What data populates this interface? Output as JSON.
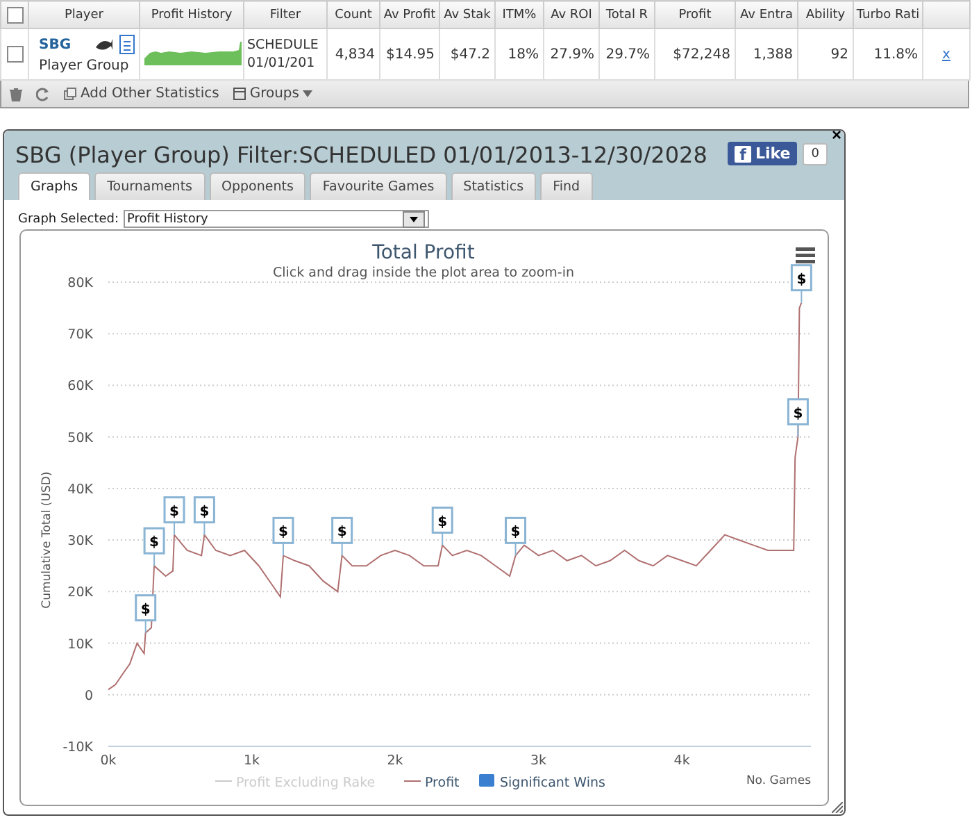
{
  "grid": {
    "columns": [
      "Player",
      "Profit History",
      "Filter",
      "Count",
      "Av Profit",
      "Av Stak",
      "ITM%",
      "Av ROI",
      "Total R",
      "Profit",
      "Av Entra",
      "Ability",
      "Turbo Rati"
    ],
    "header_checked": false,
    "rows": [
      {
        "checked": false,
        "cells": [
          {
            "name": "SBG",
            "group": "Player Group"
          },
          "",
          "SCHEDULE 01/01/201",
          "4,834",
          "$14.95",
          "$47.2",
          "18%",
          "27.9%",
          "29.7%",
          "$72,248",
          "1,388",
          "92",
          "11.8%"
        ],
        "remove": "x"
      }
    ],
    "toolbar": {
      "add_stats": "Add Other Statistics",
      "groups": "Groups"
    }
  },
  "dialog": {
    "title": "SBG (Player Group) Filter:SCHEDULED 01/01/2013-12/30/2028",
    "close": "×",
    "like": {
      "icon": "f",
      "label": "Like",
      "count": "0"
    },
    "tabs": [
      {
        "label": "Graphs",
        "selected": true
      },
      {
        "label": "Tournaments",
        "selected": false
      },
      {
        "label": "Opponents",
        "selected": false
      },
      {
        "label": "Favourite Games",
        "selected": false
      },
      {
        "label": "Statistics",
        "selected": false
      },
      {
        "label": "Find",
        "selected": false
      }
    ],
    "graph_select": {
      "label": "Graph Selected:",
      "value": "Profit History"
    },
    "chart": {
      "subtitle": "Click and drag inside the plot area to zoom-in",
      "legend": [
        {
          "label": "Profit Excluding Rake",
          "kind": "line",
          "enabled": false
        },
        {
          "kind": "series",
          "enabled": true
        },
        {
          "label": "Significant Wins",
          "kind": "square",
          "enabled": true
        }
      ],
      "chart_data": {
        "type": "line",
        "title": "Total Profit",
        "xlabel": "No. Games",
        "ylabel": "Cumulative Total (USD)",
        "x": [
          0,
          50,
          100,
          150,
          200,
          250,
          260,
          300,
          320,
          400,
          450,
          460,
          550,
          650,
          670,
          750,
          850,
          950,
          1050,
          1150,
          1200,
          1220,
          1300,
          1400,
          1500,
          1600,
          1630,
          1700,
          1800,
          1900,
          2000,
          2100,
          2200,
          2300,
          2330,
          2400,
          2500,
          2600,
          2700,
          2800,
          2840,
          2900,
          3000,
          3100,
          3200,
          3300,
          3400,
          3500,
          3600,
          3700,
          3800,
          3900,
          4000,
          4100,
          4200,
          4300,
          4400,
          4500,
          4600,
          4700,
          4780,
          4790,
          4810,
          4820,
          4834
        ],
        "grid": true,
        "series": [
          {
            "name": "Profit",
            "color": "#b07070",
            "values": [
              1000,
              2000,
              4000,
              6000,
              10000,
              8000,
              12000,
              13000,
              25000,
              23000,
              24000,
              31000,
              28000,
              27000,
              31000,
              28000,
              27000,
              28000,
              25000,
              21000,
              19000,
              27000,
              26000,
              25000,
              22000,
              20000,
              27000,
              25000,
              25000,
              27000,
              28000,
              27000,
              25000,
              25000,
              29000,
              27000,
              28000,
              27000,
              25000,
              23000,
              27000,
              29000,
              27000,
              28000,
              26000,
              27000,
              25000,
              26000,
              28000,
              26000,
              25000,
              27000,
              26000,
              25000,
              28000,
              31000,
              30000,
              29000,
              28000,
              28000,
              28000,
              46000,
              50000,
              75000,
              76000
            ]
          }
        ],
        "xlim": [
          0,
          4900
        ],
        "ylim": [
          -10000,
          80000
        ],
        "xticks": [
          {
            "value": 0,
            "label": "0k"
          },
          {
            "value": 1000,
            "label": "1k"
          },
          {
            "value": 2000,
            "label": "2k"
          },
          {
            "value": 3000,
            "label": "3k"
          },
          {
            "value": 4000,
            "label": "4k"
          }
        ],
        "yticks": [
          {
            "value": -10000,
            "label": "-10K"
          },
          {
            "value": 0,
            "label": "0"
          },
          {
            "value": 10000,
            "label": "10K"
          },
          {
            "value": 20000,
            "label": "20K"
          },
          {
            "value": 30000,
            "label": "30K"
          },
          {
            "value": 40000,
            "label": "40K"
          },
          {
            "value": 50000,
            "label": "50K"
          },
          {
            "value": 60000,
            "label": "60K"
          },
          {
            "value": 70000,
            "label": "70K"
          },
          {
            "value": 80000,
            "label": "80K"
          }
        ],
        "annotations": [
          {
            "x": 260,
            "y": 12000,
            "text": "$"
          },
          {
            "x": 320,
            "y": 25000,
            "text": "$"
          },
          {
            "x": 460,
            "y": 31000,
            "text": "$"
          },
          {
            "x": 670,
            "y": 31000,
            "text": "$"
          },
          {
            "x": 1220,
            "y": 27000,
            "text": "$"
          },
          {
            "x": 1630,
            "y": 27000,
            "text": "$"
          },
          {
            "x": 2330,
            "y": 29000,
            "text": "$"
          },
          {
            "x": 2840,
            "y": 27000,
            "text": "$"
          },
          {
            "x": 4810,
            "y": 50000,
            "text": "$"
          },
          {
            "x": 4834,
            "y": 76000,
            "text": "$"
          }
        ]
      }
    }
  }
}
